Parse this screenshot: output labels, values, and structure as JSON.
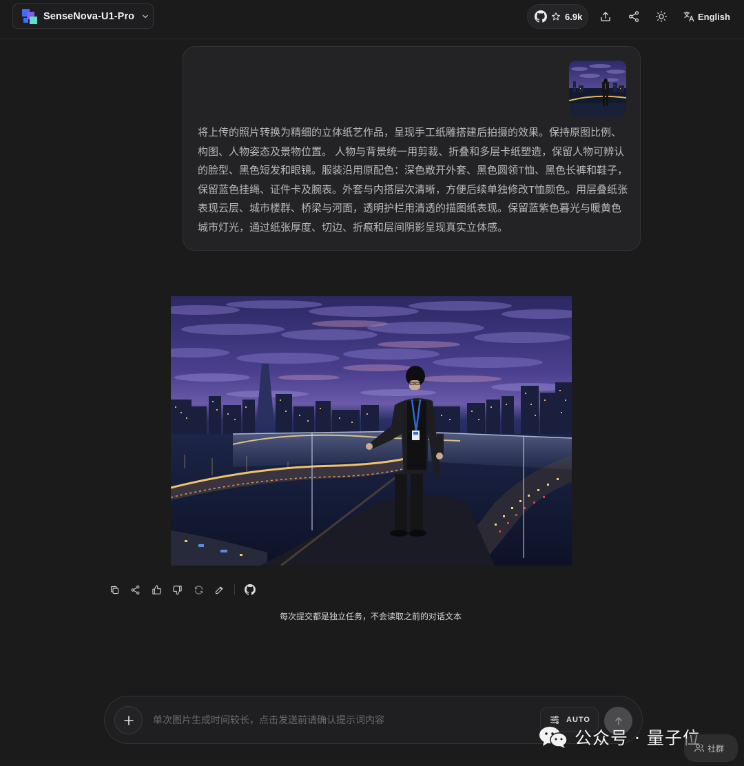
{
  "header": {
    "model_name": "SenseNova-U1-Pro",
    "github_stars": "6.9k",
    "language_label": "English"
  },
  "colors": {
    "background": "#1b1b1c",
    "card": "#232325",
    "logo_blue": "#3f6bff",
    "logo_purple": "#8b5cf6",
    "logo_teal": "#5ee0c6"
  },
  "user_message": {
    "prompt_text": "将上传的照片转换为精细的立体纸艺作品，呈现手工纸雕搭建后拍摄的效果。保持原图比例、构图、人物姿态及景物位置。 人物与背景统一用剪裁、折叠和多层卡纸塑造，保留人物可辨认的脸型、黑色短发和眼镜。服装沿用原配色：深色敞开外套、黑色圆领T恤、黑色长裤和鞋子，保留蓝色挂绳、证件卡及腕表。外套与内搭层次清晰，方便后续单独修改T恤颜色。用层叠纸张表现云层、城市楼群、桥梁与河面，透明护栏用清透的描图纸表现。保留蓝紫色暮光与暖黄色城市灯光，通过纸张厚度、切边、折痕和层间阴影呈现真实立体感。"
  },
  "actions": {
    "icons": [
      "copy-icon",
      "share-icon",
      "thumbs-up-icon",
      "thumbs-down-icon",
      "regenerate-icon",
      "edit-icon",
      "github-icon"
    ]
  },
  "notice_text": "每次提交都是独立任务，不会读取之前的对话文本",
  "composer": {
    "placeholder": "单次图片生成时间较长，点击发送前请确认提示词内容",
    "mode_label": "AUTO"
  },
  "watermark": {
    "text": "公众号 · 量子位",
    "chat_group_label": "社群"
  }
}
